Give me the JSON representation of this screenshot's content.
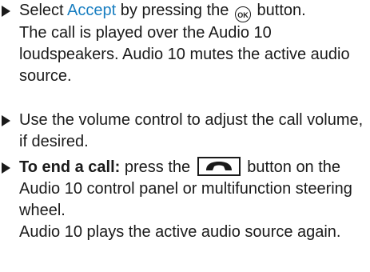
{
  "steps": [
    {
      "pre": "Select ",
      "highlight": "Accept",
      "mid": " by pressing the ",
      "button": "OK",
      "post": " button.",
      "line2": "The call is played over the Audio 10 loudspeakers. Audio 10 mutes the active audio source."
    },
    {
      "text": "Use the volume control to adjust the call volume, if desired."
    },
    {
      "bold": "To end a call:",
      "pre": " press the ",
      "button_icon": "end-call-phone-icon",
      "post": " button on the Audio 10 control panel or multifunction steering wheel.",
      "line2": "Audio 10 plays the active audio source again."
    }
  ],
  "colors": {
    "highlight": "#1a7fc1",
    "text": "#1a1a1a"
  }
}
